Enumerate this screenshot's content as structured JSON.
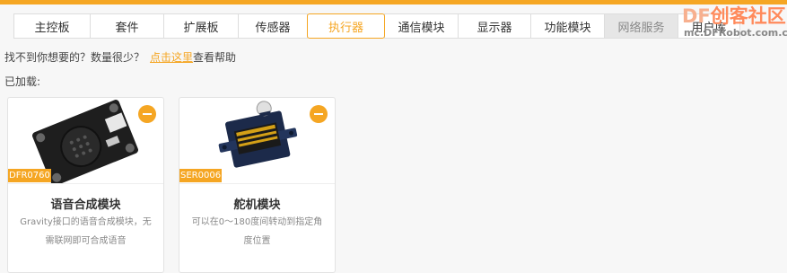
{
  "tabs": [
    {
      "label": "主控板",
      "state": "normal"
    },
    {
      "label": "套件",
      "state": "normal"
    },
    {
      "label": "扩展板",
      "state": "normal"
    },
    {
      "label": "传感器",
      "state": "normal"
    },
    {
      "label": "执行器",
      "state": "active"
    },
    {
      "label": "通信模块",
      "state": "normal"
    },
    {
      "label": "显示器",
      "state": "normal"
    },
    {
      "label": "功能模块",
      "state": "normal"
    },
    {
      "label": "网络服务",
      "state": "disabled"
    },
    {
      "label": "用户库",
      "state": "normal"
    }
  ],
  "watermark": {
    "brand": "DF",
    "title": "创客社区",
    "url": "mc.DFRobot.com.cn"
  },
  "hint": {
    "text": "找不到你想要的？数量很少？",
    "link": "点击这里",
    "suffix": "查看帮助"
  },
  "loaded_label": "已加载:",
  "cards": [
    {
      "sku": "DFR0760",
      "title": "语音合成模块",
      "desc": "Gravity接口的语音合成模块，无需联网即可合成语音"
    },
    {
      "sku": "SER0006",
      "title": "舵机模块",
      "desc": "可以在0～180度间转动到指定角度位置"
    }
  ],
  "colors": {
    "accent": "#f5a623"
  }
}
